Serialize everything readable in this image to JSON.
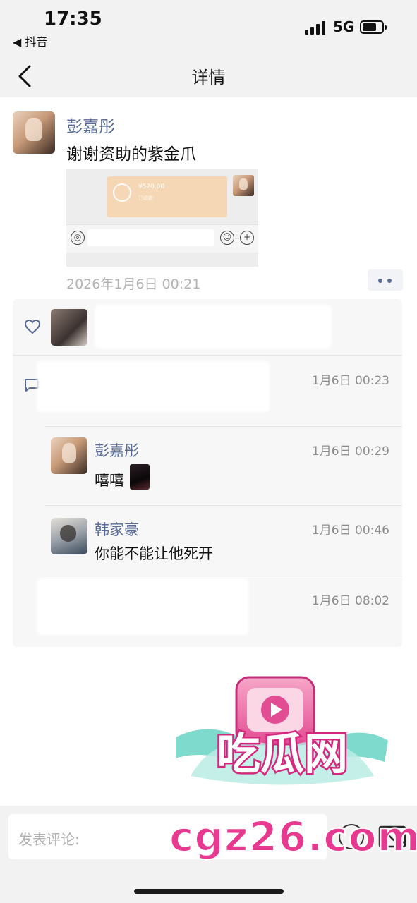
{
  "status_bar": {
    "time": "17:35",
    "back_app": "◀ 抖音",
    "network": "5G"
  },
  "nav": {
    "title": "详情"
  },
  "post": {
    "author": "彭嘉彤",
    "text": "谢谢资助的紫金爪",
    "time": "2026年1月6日 00:21",
    "image": {
      "amount": "¥520.00",
      "sub": "已收款"
    }
  },
  "comments": [
    {
      "time": "1月6日 00:23"
    },
    {
      "name": "彭嘉彤",
      "text": "嘻嘻",
      "time": "1月6日 00:29"
    },
    {
      "name": "韩家豪",
      "text": "你能不能让他死开",
      "time": "1月6日 00:46"
    },
    {
      "time": "1月6日 08:02"
    }
  ],
  "input_bar": {
    "placeholder": "发表评论:"
  },
  "watermark": {
    "logo_text": "吃瓜网",
    "url": "cgz26.com"
  },
  "colors": {
    "name_blue": "#576b95",
    "panel_bg": "#f7f7f7",
    "watermark_pink": "#e6398f"
  }
}
